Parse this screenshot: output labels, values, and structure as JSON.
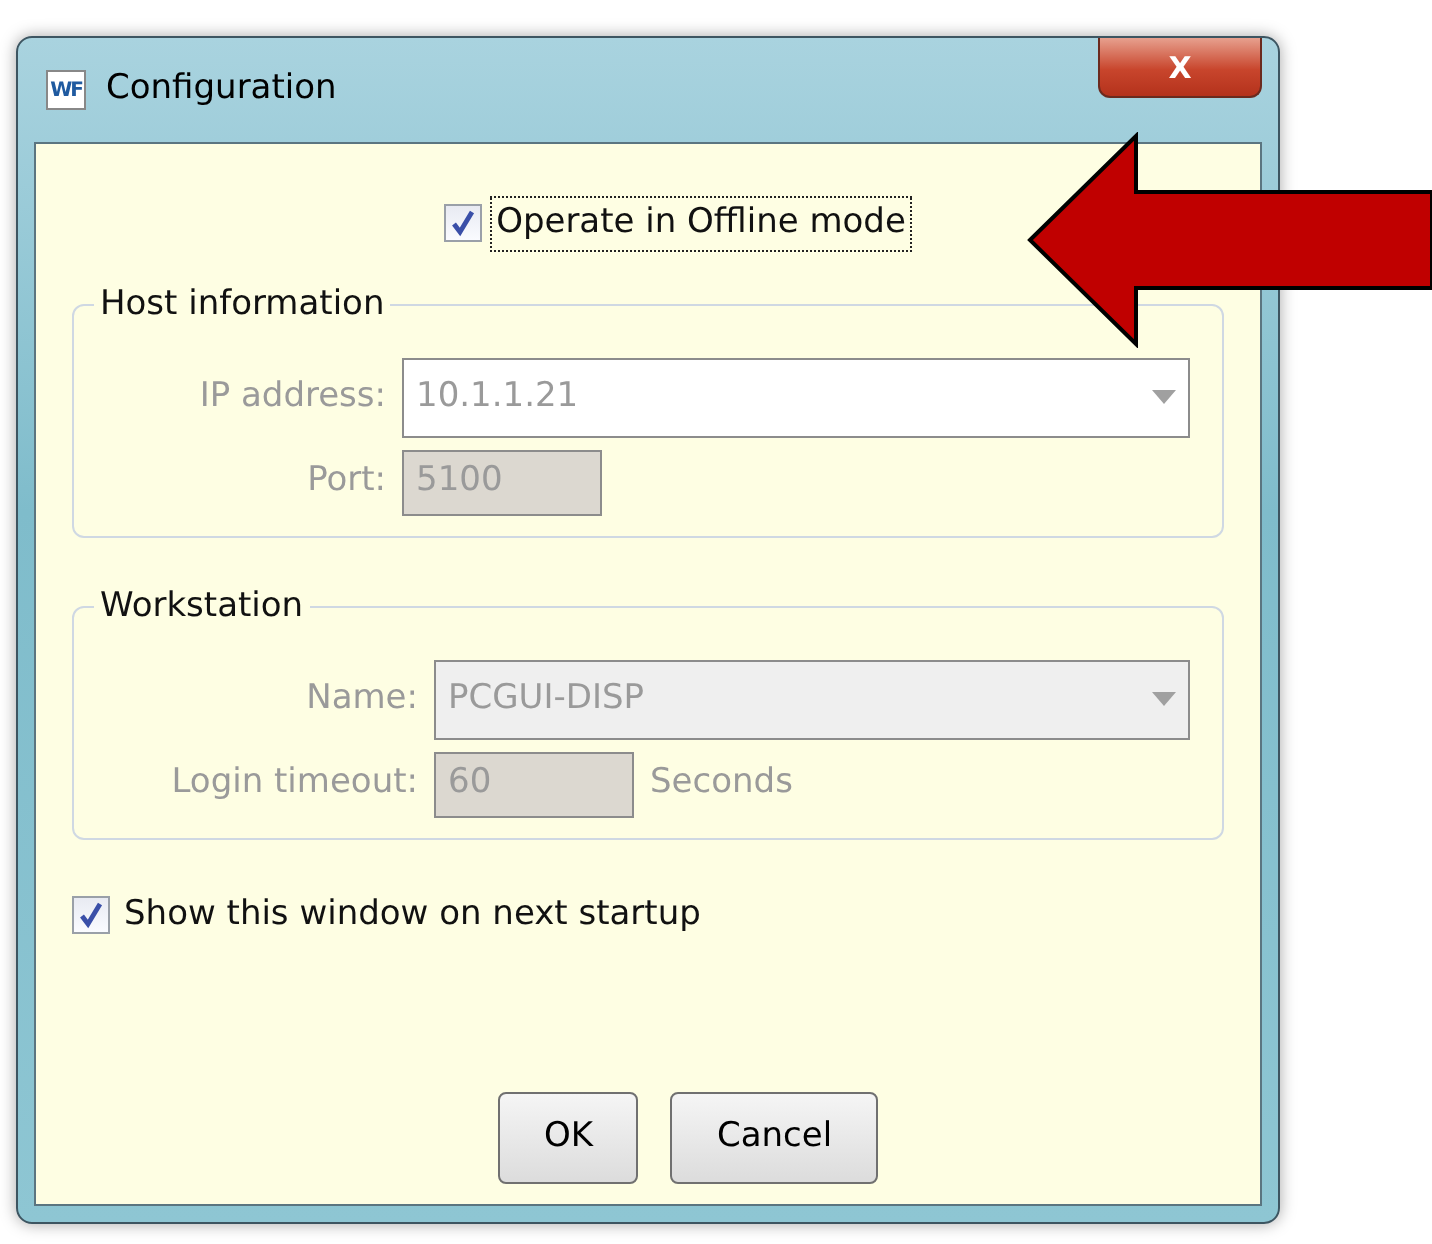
{
  "window": {
    "title": "Configuration",
    "app_icon": "WF",
    "close": "X"
  },
  "offline_mode": {
    "label": "Operate in Offline mode",
    "checked": true,
    "focused": true
  },
  "host_information": {
    "title": "Host information",
    "fields": [
      {
        "label": "IP address:",
        "value": "10.1.1.21",
        "kind": "combo",
        "disabled": true
      },
      {
        "label": "Port:",
        "value": "5100",
        "kind": "text",
        "disabled": true
      }
    ]
  },
  "workstation": {
    "title": "Workstation",
    "fields": [
      {
        "label": "Name:",
        "value": "PCGUI-DISP",
        "kind": "combo",
        "disabled": true
      },
      {
        "label": "Login timeout:",
        "value": "60",
        "kind": "text",
        "disabled": true,
        "unit": "Seconds"
      }
    ]
  },
  "show_on_startup": {
    "label": "Show this window on next startup",
    "checked": true
  },
  "buttons": [
    "OK",
    "Cancel"
  ]
}
